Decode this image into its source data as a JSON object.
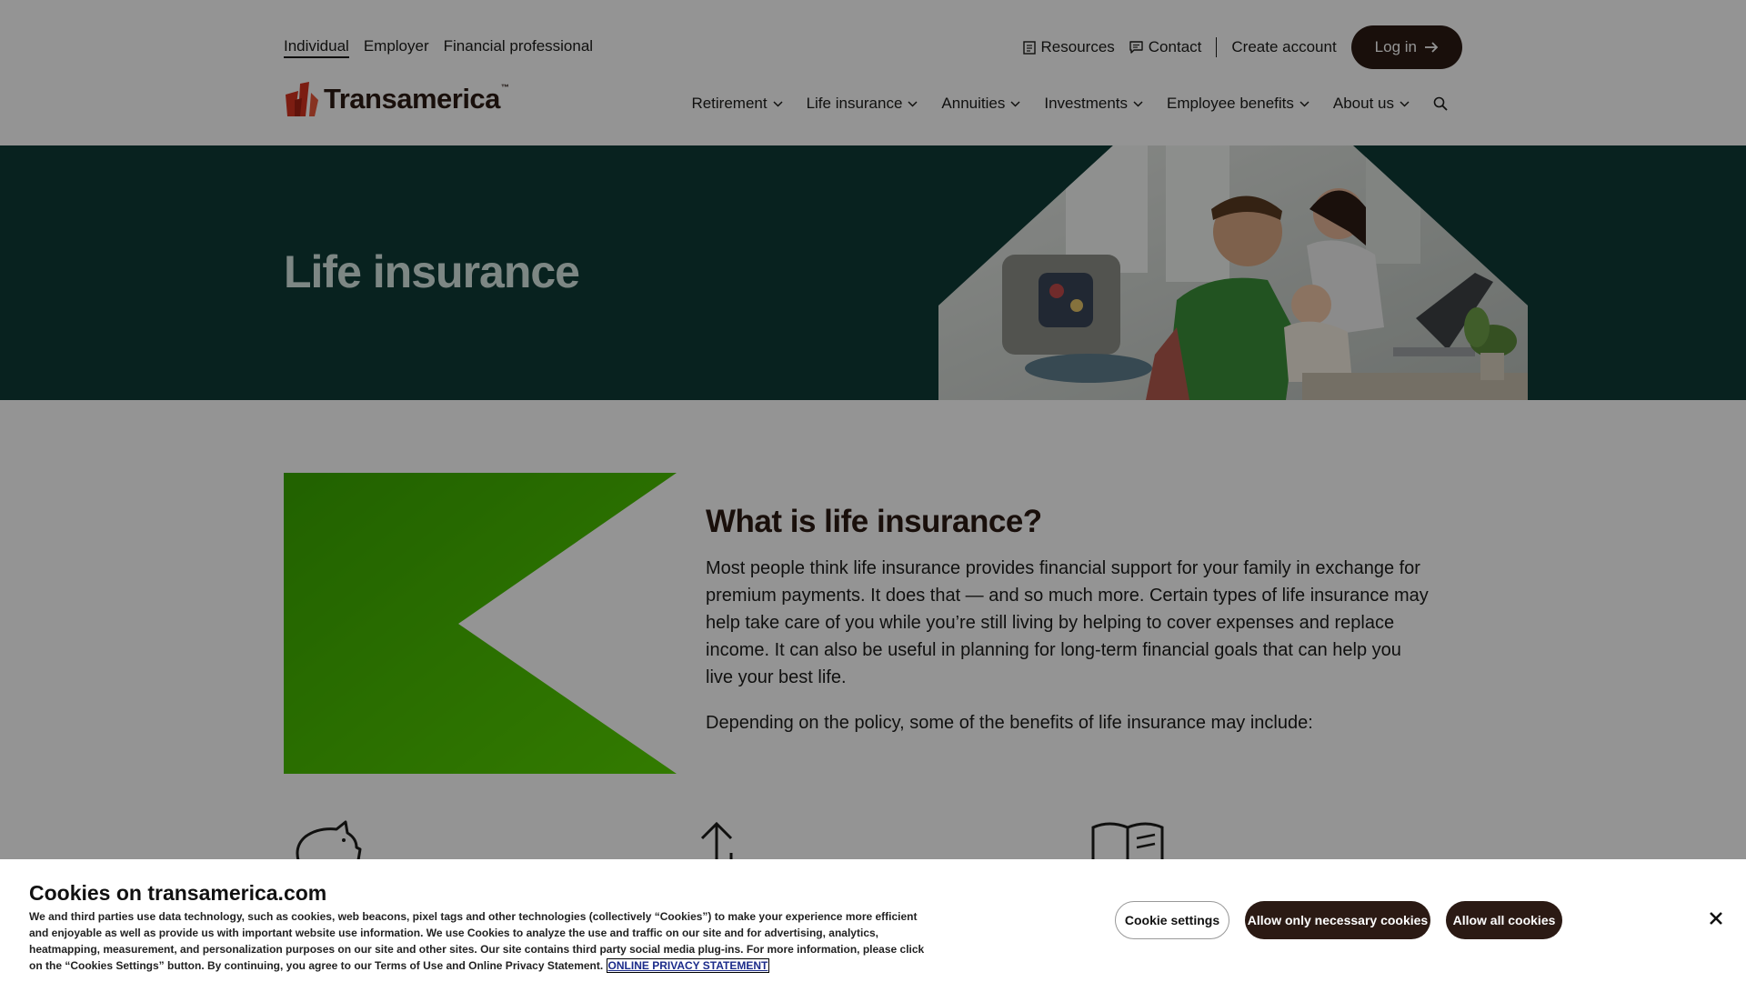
{
  "header": {
    "audience_tabs": [
      "Individual",
      "Employer",
      "Financial professional"
    ],
    "utility": {
      "resources": "Resources",
      "contact": "Contact",
      "create_account": "Create account",
      "login": "Log in"
    },
    "logo_text": "Transamerica",
    "logo_tm": "™",
    "nav": [
      "Retirement",
      "Life insurance",
      "Annuities",
      "Investments",
      "Employee benefits",
      "About us"
    ]
  },
  "hero": {
    "title": "Life insurance"
  },
  "content": {
    "heading": "What is life insurance?",
    "body": "Most people think life insurance provides financial support for your family in exchange for premium payments. It does that — and so much more. Certain types of life insurance may help take care of you while you’re still living by helping to cover expenses and replace income. It can also be useful in planning for long-term financial goals that can help you live your best life.",
    "subtext": "Depending on the policy, some of the benefits of life insurance may include:",
    "feature_icons": [
      "piggy-bank-icon",
      "arrow-up-icon",
      "open-book-icon"
    ]
  },
  "cookie_banner": {
    "title": "Cookies on transamerica.com",
    "text": "We and third parties use data technology, such as cookies, web beacons, pixel tags and other technologies (collectively “Cookies”) to make your experience more efficient and enjoyable as well as provide us with important website use information. We use Cookies to analyze the use and traffic on our site and for advertising, analytics, heatmapping, measurement, and personalization purposes on our site and other sites. Our site contains third party social media plug-ins. For more information, please click on the “Cookies Settings” button. By continuing, you agree to our Terms of Use and Online Privacy Statement.",
    "privacy_link": "ONLINE PRIVACY STATEMENT",
    "buttons": {
      "settings": "Cookie settings",
      "necessary": "Allow only necessary cookies",
      "all": "Allow all cookies"
    }
  },
  "colors": {
    "brand_dark": "#2b1a14",
    "hero_bg": "#0e3b36",
    "green_accent": "#3aa800",
    "logo_red": "#d6331f"
  }
}
